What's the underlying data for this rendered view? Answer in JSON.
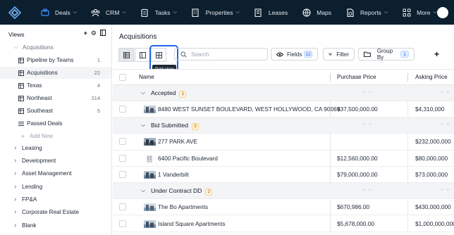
{
  "nav": {
    "items": [
      {
        "label": "Deals",
        "icon": "deals-icon",
        "has_chevron": true,
        "active": true
      },
      {
        "label": "CRM",
        "icon": "crm-icon",
        "has_chevron": true,
        "active": false
      },
      {
        "label": "Tasks",
        "icon": "tasks-icon",
        "has_chevron": true,
        "active": false
      },
      {
        "label": "Properties",
        "icon": "properties-icon",
        "has_chevron": true,
        "active": false
      },
      {
        "label": "Leases",
        "icon": "leases-icon",
        "has_chevron": false,
        "active": false
      },
      {
        "label": "Maps",
        "icon": "maps-icon",
        "has_chevron": false,
        "active": false
      },
      {
        "label": "Reports",
        "icon": "reports-icon",
        "has_chevron": true,
        "active": false
      },
      {
        "label": "More",
        "icon": "more-icon",
        "has_chevron": true,
        "active": false
      }
    ]
  },
  "sidebar": {
    "header": "Views",
    "group": "Acquisitions",
    "views": [
      {
        "label": "Pipeline by Teams",
        "count": "1"
      },
      {
        "label": "Acquisitions",
        "count": "22",
        "selected": true
      },
      {
        "label": "Texas",
        "count": "4"
      },
      {
        "label": "Northeast",
        "count": "214"
      },
      {
        "label": "Southeast",
        "count": "5"
      },
      {
        "label": "Passed Deals",
        "count": ""
      }
    ],
    "add_new": "Add New",
    "collapsed_groups": [
      "Leasing",
      "Development",
      "Asset Management",
      "Lending",
      "FP&A",
      "Corporate Real Estate",
      "Blank"
    ]
  },
  "main": {
    "title": "Acquisitions",
    "search_placeholder": "Search",
    "tooltip": "Grid view",
    "fields_label": "Fields",
    "fields_count": "12",
    "filter_label": "Filter",
    "group_by_label": "Group By",
    "group_by_count": "1"
  },
  "table": {
    "columns": [
      "Name",
      "Purchase Price",
      "Asking Price"
    ],
    "groups": [
      {
        "label": "Accepted",
        "count": "1",
        "rows": [
          {
            "name": "8480 WEST SUNSET BOULEVARD, WEST HOLLYWOOD, CA 90069",
            "purchase": "$37,500,000.00",
            "asking": "$4,310,000",
            "thumb": "photo"
          }
        ]
      },
      {
        "label": "Bid Submitted",
        "count": "3",
        "rows": [
          {
            "name": "277 PARK AVE",
            "purchase": "",
            "asking": "$232,000,000",
            "thumb": "photo"
          },
          {
            "name": "6400 Pacific Boulevard",
            "purchase": "$12,560,000.00",
            "asking": "$80,000,000",
            "thumb": "building"
          },
          {
            "name": "1 Vanderbilt",
            "purchase": "$79,000,000.00",
            "asking": "$73,000,000",
            "thumb": "photo"
          }
        ]
      },
      {
        "label": "Under Contract DD",
        "count": "2",
        "rows": [
          {
            "name": "The Bo Apartments",
            "purchase": "$670,986.00",
            "asking": "$430,000,000",
            "thumb": "photo"
          },
          {
            "name": "Island Square Apartments",
            "purchase": "$5,678,000.00",
            "asking": "$1,000,000,000",
            "thumb": "photo"
          }
        ]
      }
    ],
    "group_dash": "–"
  },
  "colors": {
    "topnav": "#0b1f2e",
    "accent": "#2563eb",
    "group_bg": "#f3f4f6"
  }
}
